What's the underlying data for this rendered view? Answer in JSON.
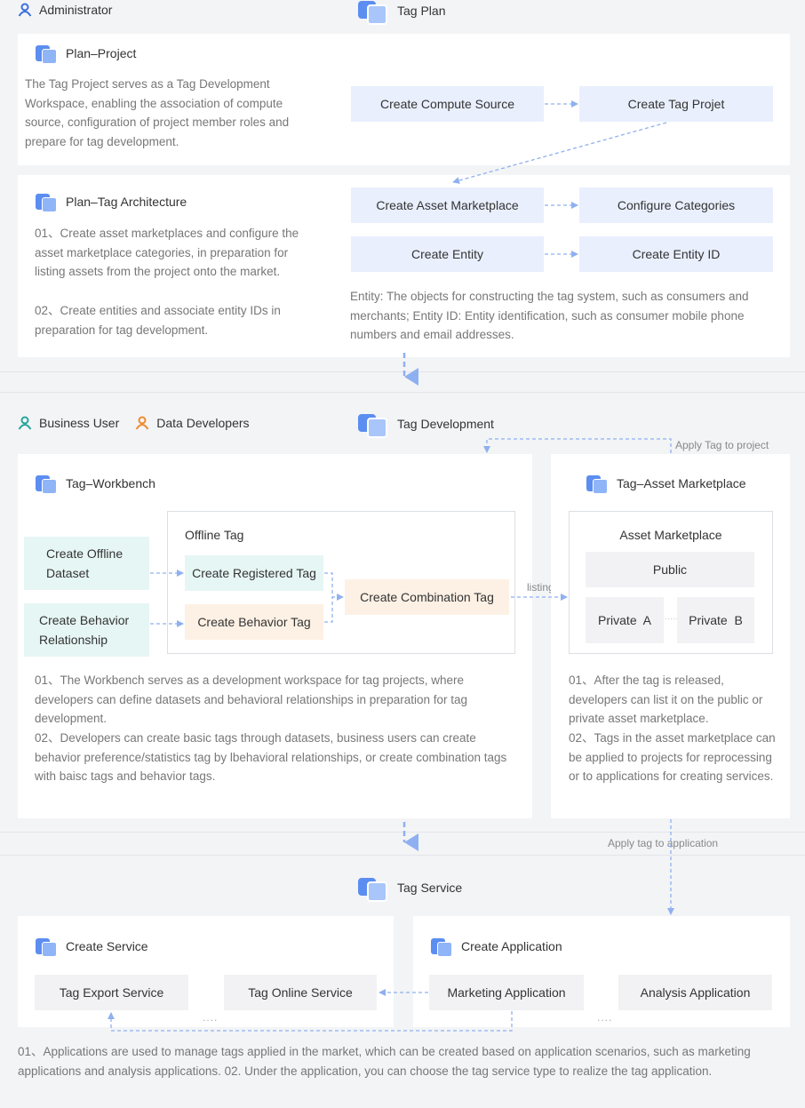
{
  "roles": {
    "administrator": "Administrator",
    "business_user": "Business User",
    "data_developers": "Data Developers"
  },
  "plan": {
    "section_title": "Tag Plan",
    "project": {
      "title": "Plan–Project",
      "description": "The Tag Project serves as a Tag Development Workspace, enabling the association of compute source, configuration of project member roles and prepare for tag development.",
      "steps": [
        "Create Compute Source",
        "Create Tag Projet"
      ]
    },
    "architecture": {
      "title": "Plan–Tag Architecture",
      "description": [
        "01、Create asset marketplaces and configure the asset marketplace categories, in preparation for listing assets from the project onto the market.",
        "02、Create entities and associate entity IDs in preparation for tag development."
      ],
      "steps": [
        "Create Asset Marketplace",
        "Configure Categories",
        "Create Entity",
        "Create Entity ID"
      ],
      "note": "Entity: The objects for constructing the tag system, such as consumers and merchants; Entity ID: Entity identification, such as consumer mobile phone numbers and email addresses."
    }
  },
  "development": {
    "section_title": "Tag Development",
    "apply_to_project": "Apply Tag to project",
    "workbench": {
      "title": "Tag–Workbench",
      "offline_tag_title": "Offline Tag",
      "inputs": [
        "Create Offline Dataset",
        "Create Behavior Relationship"
      ],
      "tags": [
        "Create Registered Tag",
        "Create Behavior Tag",
        "Create Combination Tag"
      ],
      "description": [
        "01、The Workbench serves as a development workspace for tag projects, where developers can define datasets and behavioral relationships in preparation for tag development.",
        "02、Developers can create basic tags through datasets, business users can create behavior preference/statistics tag by lbehavioral relationships, or create combination tags with baisc tags and behavior tags."
      ]
    },
    "listing_label": "listing",
    "marketplace": {
      "title": "Tag–Asset Marketplace",
      "box_title": "Asset Marketplace",
      "public": "Public",
      "private_a": "Private  A",
      "private_b": "Private  B",
      "dots": "......",
      "description": [
        "01、After the tag is released, developers can list it on the public or private asset marketplace.",
        "02、Tags in the asset marketplace can be applied to projects for reprocessing or to applications for creating services."
      ]
    }
  },
  "service": {
    "section_title": "Tag Service",
    "apply_to_application": "Apply tag to application",
    "create_service": {
      "title": "Create Service",
      "items": [
        "Tag Export Service",
        "Tag Online Service"
      ],
      "dots": "...."
    },
    "create_application": {
      "title": "Create Application",
      "items": [
        "Marketing Application",
        "Analysis Application"
      ],
      "dots": "...."
    },
    "description": "01、Applications are used to manage tags applied in the market, which can be created based on application scenarios, such as marketing applications and analysis applications. 02. Under the application, you can choose the tag service type to realize the tag application."
  },
  "colors": {
    "accent_blue": "#5b8ef0",
    "user_orange": "#f08a2e",
    "user_teal": "#26a59a",
    "box_blue": "#e9effd",
    "box_teal": "#e6f6f4",
    "box_peach": "#fdf1e5"
  }
}
